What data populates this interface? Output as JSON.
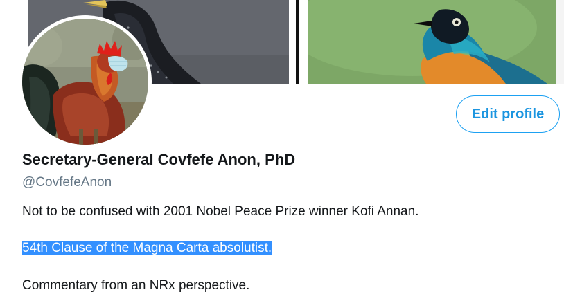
{
  "profile": {
    "display_name": "Secretary-General Covfefe Anon, PhD",
    "handle": "@CovfefeAnon",
    "bio": [
      "Not to be confused with 2001 Nobel Peace Prize winner Kofi Annan.",
      "54th Clause of the Magna Carta absolutist.",
      "Commentary from an NRx perspective."
    ],
    "selected_bio_line_index": 1
  },
  "actions": {
    "edit_profile_label": "Edit profile"
  },
  "colors": {
    "accent": "#1da1f2",
    "accent_text": "#1b95e0",
    "name_text": "#14171a",
    "handle_text": "#657786",
    "selection": "#3390ff"
  },
  "images": {
    "banner_left": "starling-photo",
    "banner_right": "superb-starling-photo",
    "avatar": "rooster-with-face-mask-photo"
  }
}
